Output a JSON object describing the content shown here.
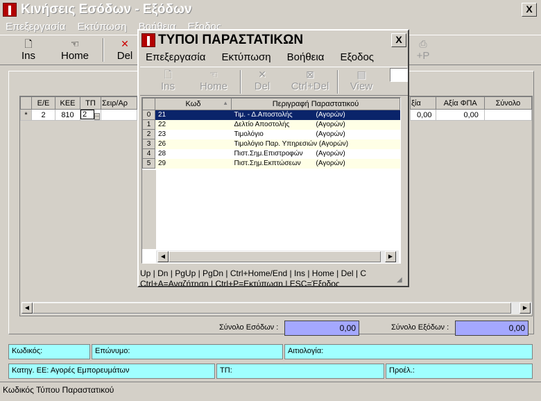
{
  "window": {
    "title": "Κινήσεις Εσόδων - Εξόδων",
    "close": "X"
  },
  "menu": [
    "Επεξεργασία",
    "Εκτύπωση",
    "Βοήθεια",
    "Εξοδος"
  ],
  "toolbar": {
    "ins": "Ins",
    "home": "Home",
    "del": "Del",
    "ctrlp": "+P"
  },
  "grid": {
    "headers": [
      "Ε/Ε",
      "ΚΕΕ",
      "ΤΠ",
      "Σειρ/Αρ",
      "ξία",
      "Αξία ΦΠΑ",
      "Σύνολο"
    ],
    "row": {
      "marker": "*",
      "ee": "2",
      "kee": "810",
      "tp": "2",
      "val1": "0,00",
      "val2": "0,00"
    }
  },
  "totals": {
    "income_label": "Σύνολο Εσόδων :",
    "income_value": "0,00",
    "expense_label": "Σύνολο Εξόδων :",
    "expense_value": "0,00"
  },
  "fields": {
    "code": "Κωδικός:",
    "surname": "Επώνυμο:",
    "reason": "Αιτιολογία:",
    "category": "Κατηγ. ΕΕ: Αγορές Εμπορευμάτων",
    "tp": "ΤΠ:",
    "origin": "Προέλ.:"
  },
  "status": "Κωδικός Τύπου Παραστατικού",
  "dialog": {
    "title": "ΤΥΠΟΙ ΠΑΡΑΣΤΑΤΙΚΩΝ",
    "close": "X",
    "menu": [
      "Επεξεργασία",
      "Εκτύπωση",
      "Βοήθεια",
      "Εξοδος"
    ],
    "toolbar": {
      "ins": "Ins",
      "home": "Home",
      "del": "Del",
      "ctrldel": "Ctrl+Del",
      "view": "View"
    },
    "headers": {
      "code": "Κωδ",
      "desc": "Περιγραφή Παραστατικού"
    },
    "rows": [
      {
        "idx": "0",
        "code": "21",
        "desc": "Τιμ. - Δ.Αποστολής",
        "type": "(Αγορών)"
      },
      {
        "idx": "1",
        "code": "22",
        "desc": "Δελτίο Αποστολής",
        "type": "(Αγορών)"
      },
      {
        "idx": "2",
        "code": "23",
        "desc": "Τιμολόγιο",
        "type": "(Αγορών)"
      },
      {
        "idx": "3",
        "code": "26",
        "desc": "Τιμολόγιο Παρ. Υπηρεσιών",
        "type": "(Αγορών)"
      },
      {
        "idx": "4",
        "code": "28",
        "desc": "Πιστ.Σημ.Επιστροφών",
        "type": "(Αγορών)"
      },
      {
        "idx": "5",
        "code": "29",
        "desc": "Πιστ.Σημ.Εκπτώσεων",
        "type": "(Αγορών)"
      }
    ],
    "hints1": "Up | Dn | PgUp | PgDn | Ctrl+Home/End | Ins | Home | Del | C",
    "hints2": "Ctrl+A=Αναζήτηση | Ctrl+P=Εκτύπωση | ESC=Έξοδος"
  }
}
